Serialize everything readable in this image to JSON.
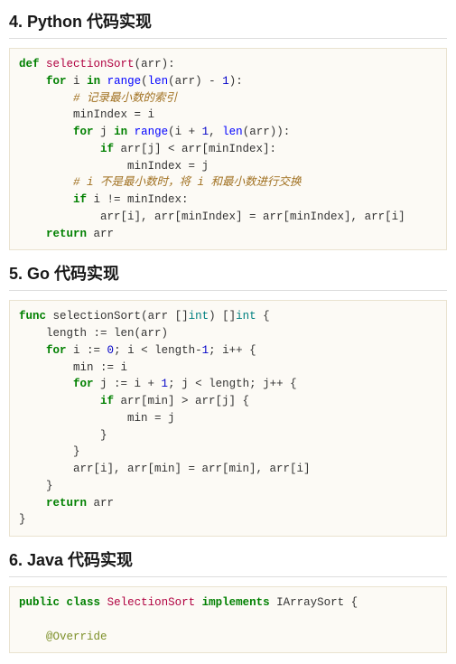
{
  "sections": {
    "python": {
      "heading": "4. Python 代码实现"
    },
    "go": {
      "heading": "5. Go 代码实现"
    },
    "java": {
      "heading": "6. Java 代码实现"
    }
  },
  "code": {
    "py": {
      "t_def": "def",
      "t_fn": "selectionSort",
      "t_lp": "(arr):",
      "t_for1a": "for",
      "t_for1b": "i",
      "t_for1c": "in",
      "t_for1d": "range",
      "t_for1e": "(",
      "t_for1f": "len",
      "t_for1g": "(arr)",
      "t_for1h": " - ",
      "t_for1i": "1",
      "t_for1j": "):",
      "t_cm1": "# 记录最小数的索引",
      "t_minidx": "minIndex = i",
      "t_for2a": "for",
      "t_for2b": "j",
      "t_for2c": "in",
      "t_for2d": "range",
      "t_for2e": "(i + ",
      "t_for2f": "1",
      "t_for2g": ", ",
      "t_for2h": "len",
      "t_for2i": "(arr)):",
      "t_ifa": "if",
      "t_ifb": " arr[j] < arr[minIndex]:",
      "t_set": "minIndex = j",
      "t_cm2": "# i 不是最小数时，将 i 和最小数进行交换",
      "t_if2a": "if",
      "t_if2b": " i != minIndex:",
      "t_swap": "arr[i], arr[minIndex] = arr[minIndex], arr[i]",
      "t_ret": "return",
      "t_retv": " arr"
    },
    "go": {
      "t_func": "func",
      "t_fn": "selectionSort",
      "t_sig": "(arr []",
      "t_int1": "int",
      "t_sig2": ") []",
      "t_int2": "int",
      "t_brace": " {",
      "t_len": "length := len(arr)",
      "t_for1a": "for",
      "t_for1b": " i := ",
      "t_zero": "0",
      "t_for1c": "; i < length-",
      "t_one": "1",
      "t_for1d": "; i++ {",
      "t_min": "min := i",
      "t_for2a": "for",
      "t_for2b": " j := i + ",
      "t_one2": "1",
      "t_for2c": "; j < length; j++ {",
      "t_ifa": "if",
      "t_ifb": " arr[min] > arr[j] {",
      "t_set": "min = j",
      "t_rb1": "}",
      "t_rb2": "}",
      "t_swap": "arr[i], arr[min] = arr[min], arr[i]",
      "t_rb3": "}",
      "t_ret": "return",
      "t_retv": " arr",
      "t_rb4": "}"
    },
    "java": {
      "t_pub": "public",
      "t_class": "class",
      "t_name": "SelectionSort",
      "t_impl": "implements",
      "t_iface": "IArraySort {",
      "t_override": "@Override"
    }
  }
}
